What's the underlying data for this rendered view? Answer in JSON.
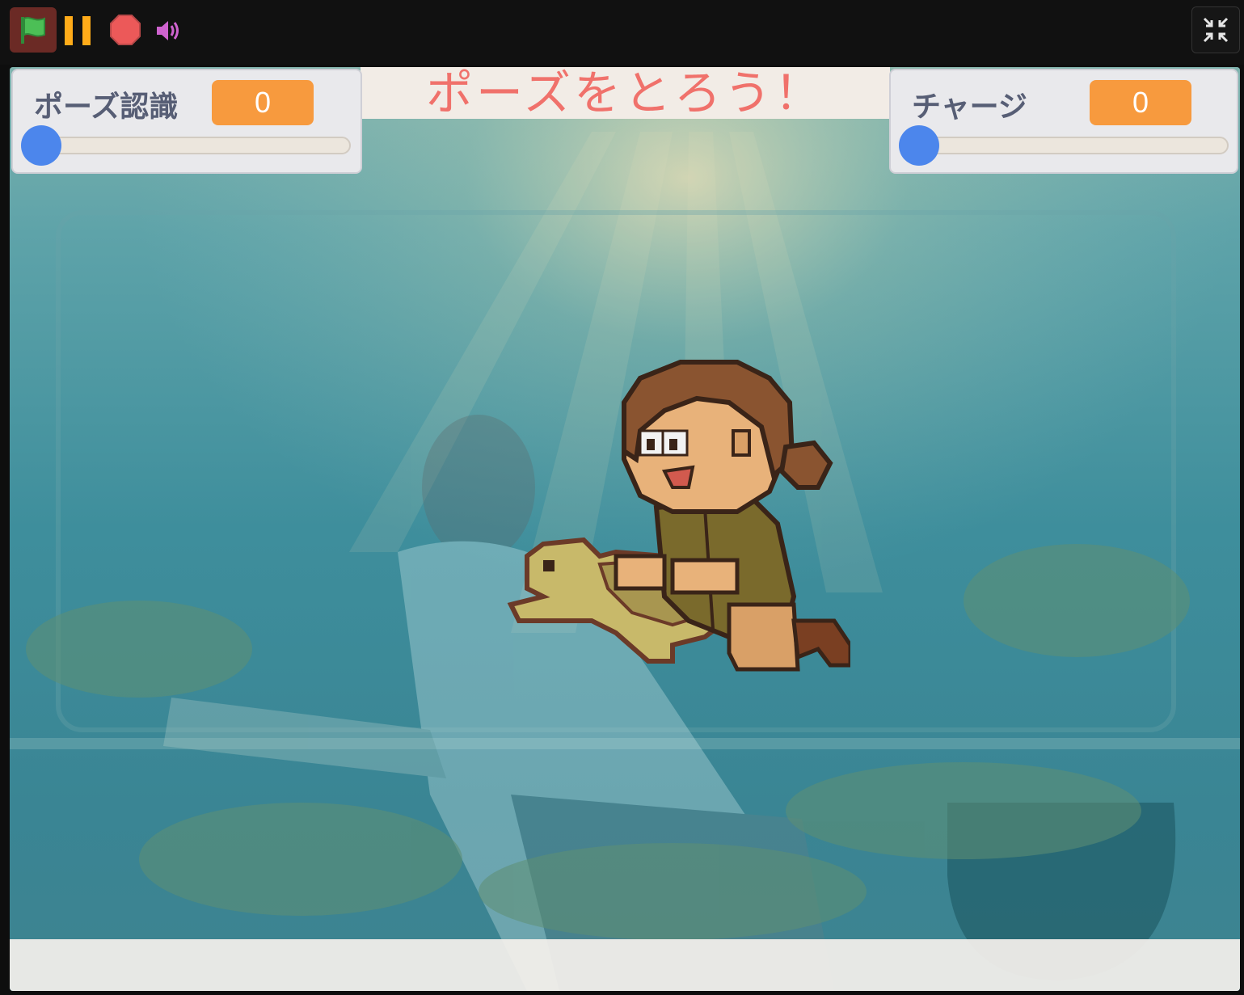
{
  "toolbar": {
    "green_flag": "green-flag-icon",
    "pause": "pause-icon",
    "stop": "stop-icon",
    "sound": "sound-icon",
    "fullscreen_exit": "fullscreen-exit-icon"
  },
  "stage": {
    "title": "ポーズをとろう！",
    "monitors": [
      {
        "label": "ポーズ認識",
        "value": "0",
        "slider_fraction": 0
      },
      {
        "label": "チャージ",
        "value": "0",
        "slider_fraction": 0
      }
    ],
    "sprite": "character-riding-turtle"
  },
  "colors": {
    "toolbar_bg": "#111111",
    "title": "#f0716b",
    "monitor_value_bg": "#f79a3e",
    "slider_knob": "#4c86ec",
    "sea": "#3f8d9c"
  }
}
